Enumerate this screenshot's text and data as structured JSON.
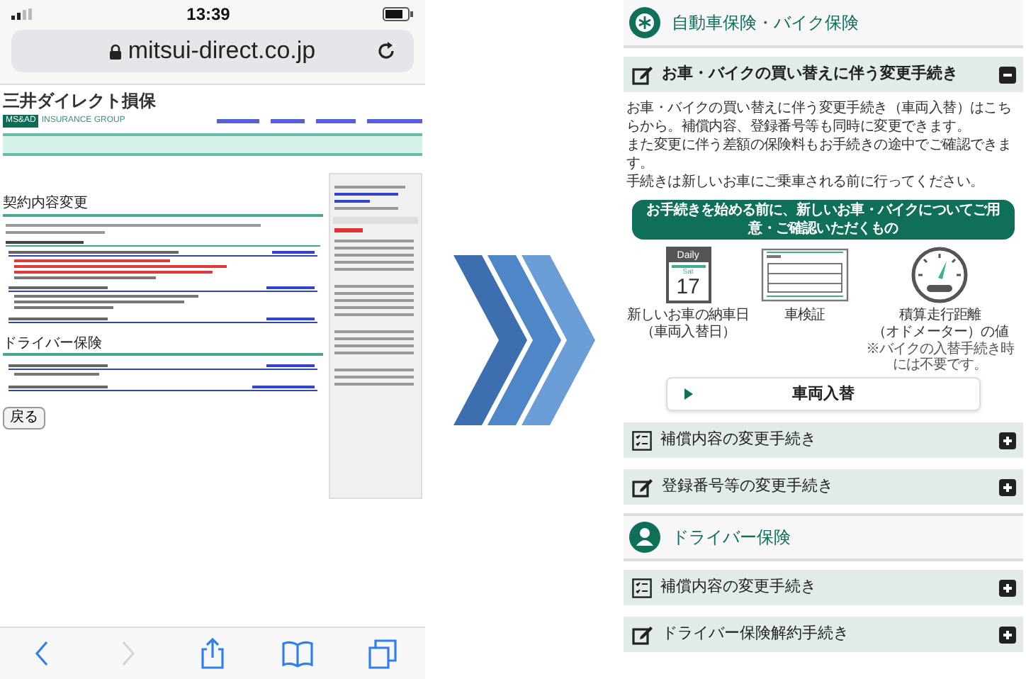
{
  "phone_before": {
    "status_bar": {
      "time": "13:39"
    },
    "address_bar": {
      "url": "mitsui-direct.co.jp"
    },
    "page": {
      "logo": "三井ダイレクト損保",
      "group_badge": "MS&AD",
      "group_name": "INSURANCE GROUP",
      "heading": "契約内容変更",
      "section": "ドライバー保険",
      "back_button": "戻る"
    },
    "toolbar": [
      {
        "kind": "back",
        "disabled": false
      },
      {
        "kind": "forward",
        "disabled": true
      },
      {
        "kind": "share",
        "disabled": false
      },
      {
        "kind": "bookmarks",
        "disabled": false
      },
      {
        "kind": "tabs",
        "disabled": false
      }
    ]
  },
  "phone_after": {
    "sections": [
      {
        "kind": "car",
        "title": "自動車保険・バイク保険",
        "items": [
          {
            "kind": "edit",
            "label": "お車・バイクの買い替えに伴う変更手続き",
            "expanded": true,
            "description": [
              "お車・バイクの買い替えに伴う変更手続き（車両入替）はこちらから。補償内容、登録番号等も同時に変更できます。",
              "また変更に伴う差額の保険料もお手続きの途中でご確認できます。",
              "手続きは新しいお車にご乗車される前に行ってください。"
            ],
            "banner": "お手続きを始める前に、新しいお車・バイクについてご用意・ご確認いただくもの",
            "requirements": [
              {
                "kind": "calendar",
                "icon_texts": [
                  "Daily",
                  "Sat",
                  "17"
                ],
                "lines": [
                  "新しいお車の納車日",
                  "（車両入替日）"
                ]
              },
              {
                "kind": "certificate",
                "lines": [
                  "車検証"
                ]
              },
              {
                "kind": "odometer",
                "lines": [
                  "積算走行距離",
                  "（オドメーター）の値"
                ],
                "note": "※バイクの入替手続き時には不要です。"
              }
            ],
            "action": "車両入替"
          },
          {
            "kind": "checklist",
            "label": "補償内容の変更手続き",
            "expanded": false
          },
          {
            "kind": "edit",
            "label": "登録番号等の変更手続き",
            "expanded": false
          }
        ]
      },
      {
        "kind": "driver",
        "title": "ドライバー保険",
        "items": [
          {
            "kind": "checklist",
            "label": "補償内容の変更手続き",
            "expanded": false
          },
          {
            "kind": "edit",
            "label": "ドライバー保険解約手続き",
            "expanded": false
          }
        ]
      }
    ]
  }
}
